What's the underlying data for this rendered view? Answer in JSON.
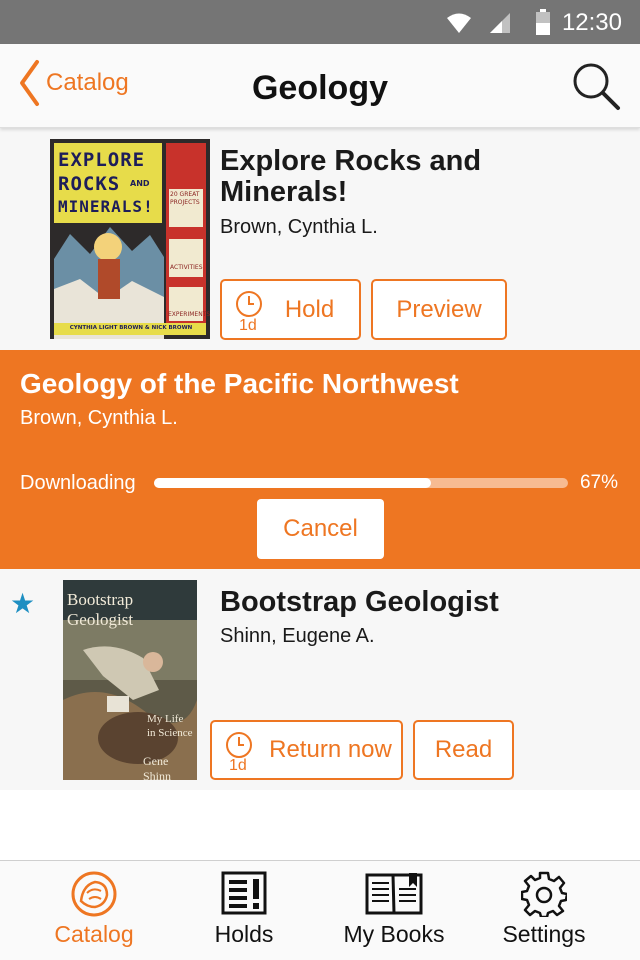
{
  "status_bar": {
    "time": "12:30"
  },
  "header": {
    "back_label": "Catalog",
    "title": "Geology"
  },
  "books": [
    {
      "title_line1": "Explore Rocks and",
      "title_line2": "Minerals!",
      "author": "Brown, Cynthia L.",
      "hold_label": "Hold",
      "hold_time": "1d",
      "preview_label": "Preview",
      "cover": {
        "line1": "EXPLORE",
        "line2": "ROCKS",
        "line2b": "AND",
        "line3": "MINERALS!",
        "panel_text": "20 GREAT PROJECTS",
        "activities": "ACTIVITIES",
        "experiments": "EXPERIMENTS",
        "authors": "CYNTHIA LIGHT BROWN & NICK BROWN"
      }
    },
    {
      "title": "Geology of the Pacific Northwest",
      "author": "Brown, Cynthia L.",
      "downloading_label": "Downloading",
      "progress": 0.67,
      "progress_label": "67%",
      "cancel_label": "Cancel"
    },
    {
      "title": "Bootstrap Geologist",
      "author": "Shinn, Eugene A.",
      "return_label": "Return now",
      "return_time": "1d",
      "read_label": "Read",
      "starred": true,
      "cover": {
        "title": "Bootstrap Geologist",
        "subtitle_line1": "My Life",
        "subtitle_line2": "in Science",
        "author": "Gene Shinn"
      }
    }
  ],
  "tabs": [
    {
      "label": "Catalog",
      "icon": "lion-logo-icon",
      "active": true
    },
    {
      "label": "Holds",
      "icon": "holds-icon",
      "active": false
    },
    {
      "label": "My Books",
      "icon": "my-books-icon",
      "active": false
    },
    {
      "label": "Settings",
      "icon": "gear-icon",
      "active": false
    }
  ],
  "colors": {
    "accent": "#ee7622",
    "star": "#1e8fc2",
    "status_bar": "#757575"
  }
}
